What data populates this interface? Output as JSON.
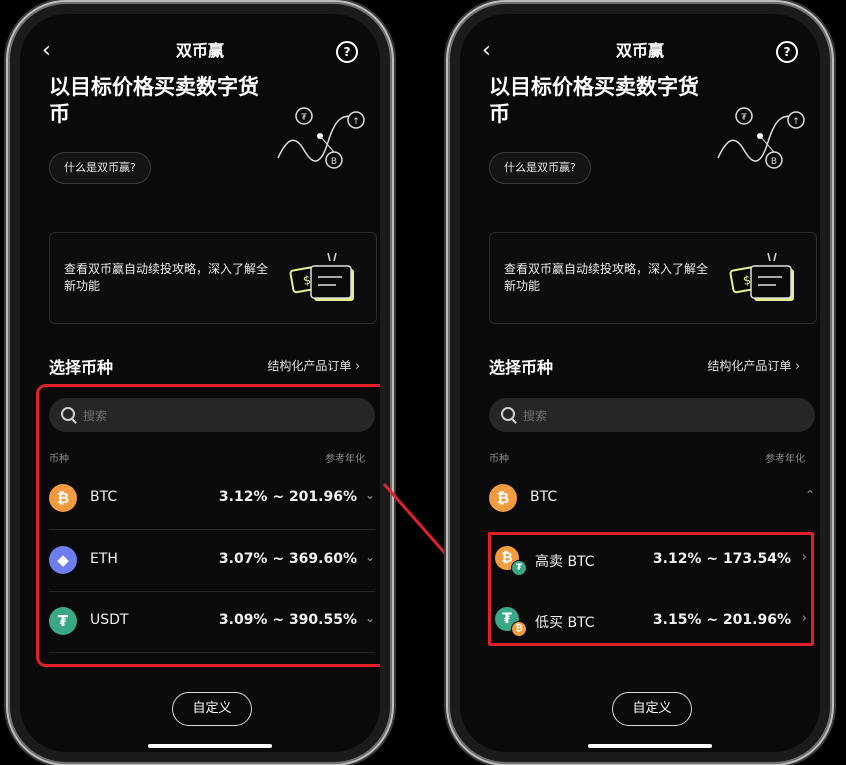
{
  "nav": {
    "title": "双币赢",
    "back": "‹",
    "help": "?"
  },
  "hero": {
    "title": "以目标价格买卖数字货币",
    "what_button": "什么是双币赢?"
  },
  "promo": {
    "text": "查看双币赢自动续投攻略，深入了解全新功能"
  },
  "section": {
    "title": "选择币种",
    "link": "结构化产品订单 ›"
  },
  "search": {
    "placeholder": "搜索"
  },
  "columns": {
    "coin": "币种",
    "apr": "参考年化"
  },
  "left_list": [
    {
      "symbol": "BTC",
      "rate": "3.12% ~ 201.96%",
      "icon": "bitcoin-icon",
      "glyph": "₿",
      "color": "#f39c3f"
    },
    {
      "symbol": "ETH",
      "rate": "3.07% ~ 369.60%",
      "icon": "ethereum-icon",
      "glyph": "◆",
      "color": "#6d7ff0"
    },
    {
      "symbol": "USDT",
      "rate": "3.09% ~ 390.55%",
      "icon": "tether-icon",
      "glyph": "₮",
      "color": "#3aa887"
    }
  ],
  "right_expanded": {
    "symbol": "BTC",
    "options": [
      {
        "label": "高卖 BTC",
        "rate": "3.12% ~ 173.54%"
      },
      {
        "label": "低买 BTC",
        "rate": "3.15% ~ 201.96%"
      }
    ]
  },
  "custom_button": "自定义",
  "colors": {
    "highlight": "#e0202a",
    "btc": "#f39c3f",
    "eth": "#6d7ff0",
    "usdt": "#3aa887"
  }
}
